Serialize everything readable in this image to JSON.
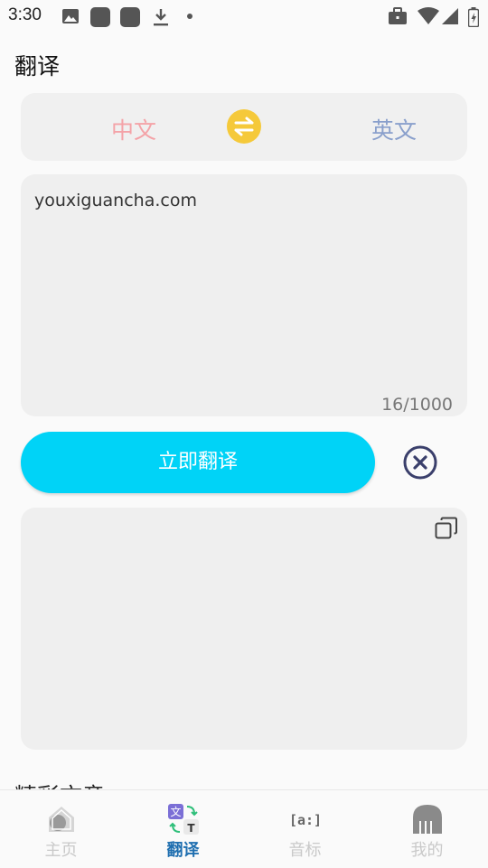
{
  "status_bar": {
    "time": "3:30"
  },
  "header": {
    "title": "翻译"
  },
  "language": {
    "source": "中文",
    "target": "英文"
  },
  "input": {
    "text": "youxiguancha.com",
    "counter": "16/1000"
  },
  "actions": {
    "translate_label": "立即翻译"
  },
  "section": {
    "title": "精彩文章"
  },
  "nav": {
    "items": [
      {
        "label": "主页",
        "icon": "home-icon",
        "active": false
      },
      {
        "label": "翻译",
        "icon": "translate-icon",
        "active": true
      },
      {
        "label": "音标",
        "icon": "phonetic-icon",
        "active": false
      },
      {
        "label": "我的",
        "icon": "profile-icon",
        "active": false
      }
    ]
  },
  "colors": {
    "accent": "#00d3f7",
    "swap": "#f5c93a",
    "source_lang": "#f4a3a8",
    "target_lang": "#8aa0cc",
    "nav_active": "#1f6fb0"
  }
}
